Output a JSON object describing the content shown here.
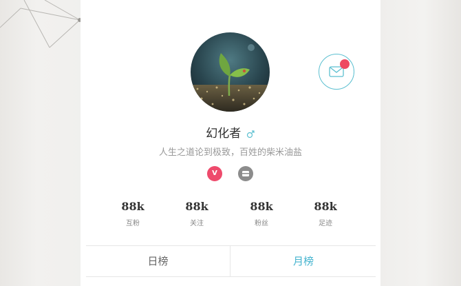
{
  "profile": {
    "name": "幻化者",
    "gender_icon": "male-icon",
    "bio": "人生之道论到极致，百姓的柴米油盐",
    "avatar": "seedling-photo"
  },
  "badges": [
    {
      "icon": "vip-badge-icon",
      "text": "V",
      "color": "#ee4a6c"
    },
    {
      "icon": "level-badge-icon",
      "color": "#8c8c8c"
    }
  ],
  "message": {
    "icon": "mail-icon",
    "unread_color": "#ee4a62"
  },
  "stats": [
    {
      "value": "88k",
      "label": "互粉"
    },
    {
      "value": "88k",
      "label": "关注"
    },
    {
      "value": "88k",
      "label": "粉丝"
    },
    {
      "value": "88k",
      "label": "足迹"
    }
  ],
  "tabs": {
    "daily": "日榜",
    "monthly": "月榜",
    "active": "monthly"
  },
  "colors": {
    "accent": "#45b4cf",
    "badge_pink": "#ee4a6c"
  }
}
